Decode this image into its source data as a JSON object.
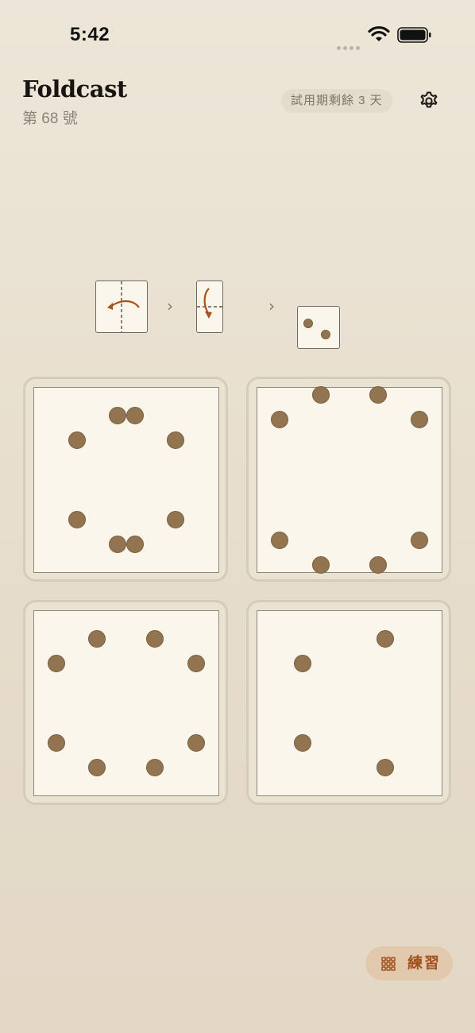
{
  "status_bar": {
    "time": "5:42"
  },
  "header": {
    "title": "Foldcast",
    "issue": "第 68 號",
    "trial_badge": "試用期剩餘 3 天"
  },
  "icons": [
    "wifi-icon",
    "battery-icon",
    "gear-icon",
    "unfold-arrow-icon",
    "chevron-right-icon",
    "grid-icon"
  ],
  "sequence": {
    "steps": [
      "fold-left",
      "fold-down",
      "punched-result"
    ],
    "result_holes": 2
  },
  "answer_options": [
    {
      "id": "A",
      "hole_count": 8
    },
    {
      "id": "B",
      "hole_count": 8
    },
    {
      "id": "C",
      "hole_count": 8
    },
    {
      "id": "D",
      "hole_count": 4
    }
  ],
  "practice_button": {
    "label": "練習"
  },
  "colors": {
    "background": "#e6dccb",
    "paper": "#fbf6ec",
    "hole": "#927450",
    "accent": "#a0531f",
    "fold_arrow": "#a8521c"
  }
}
